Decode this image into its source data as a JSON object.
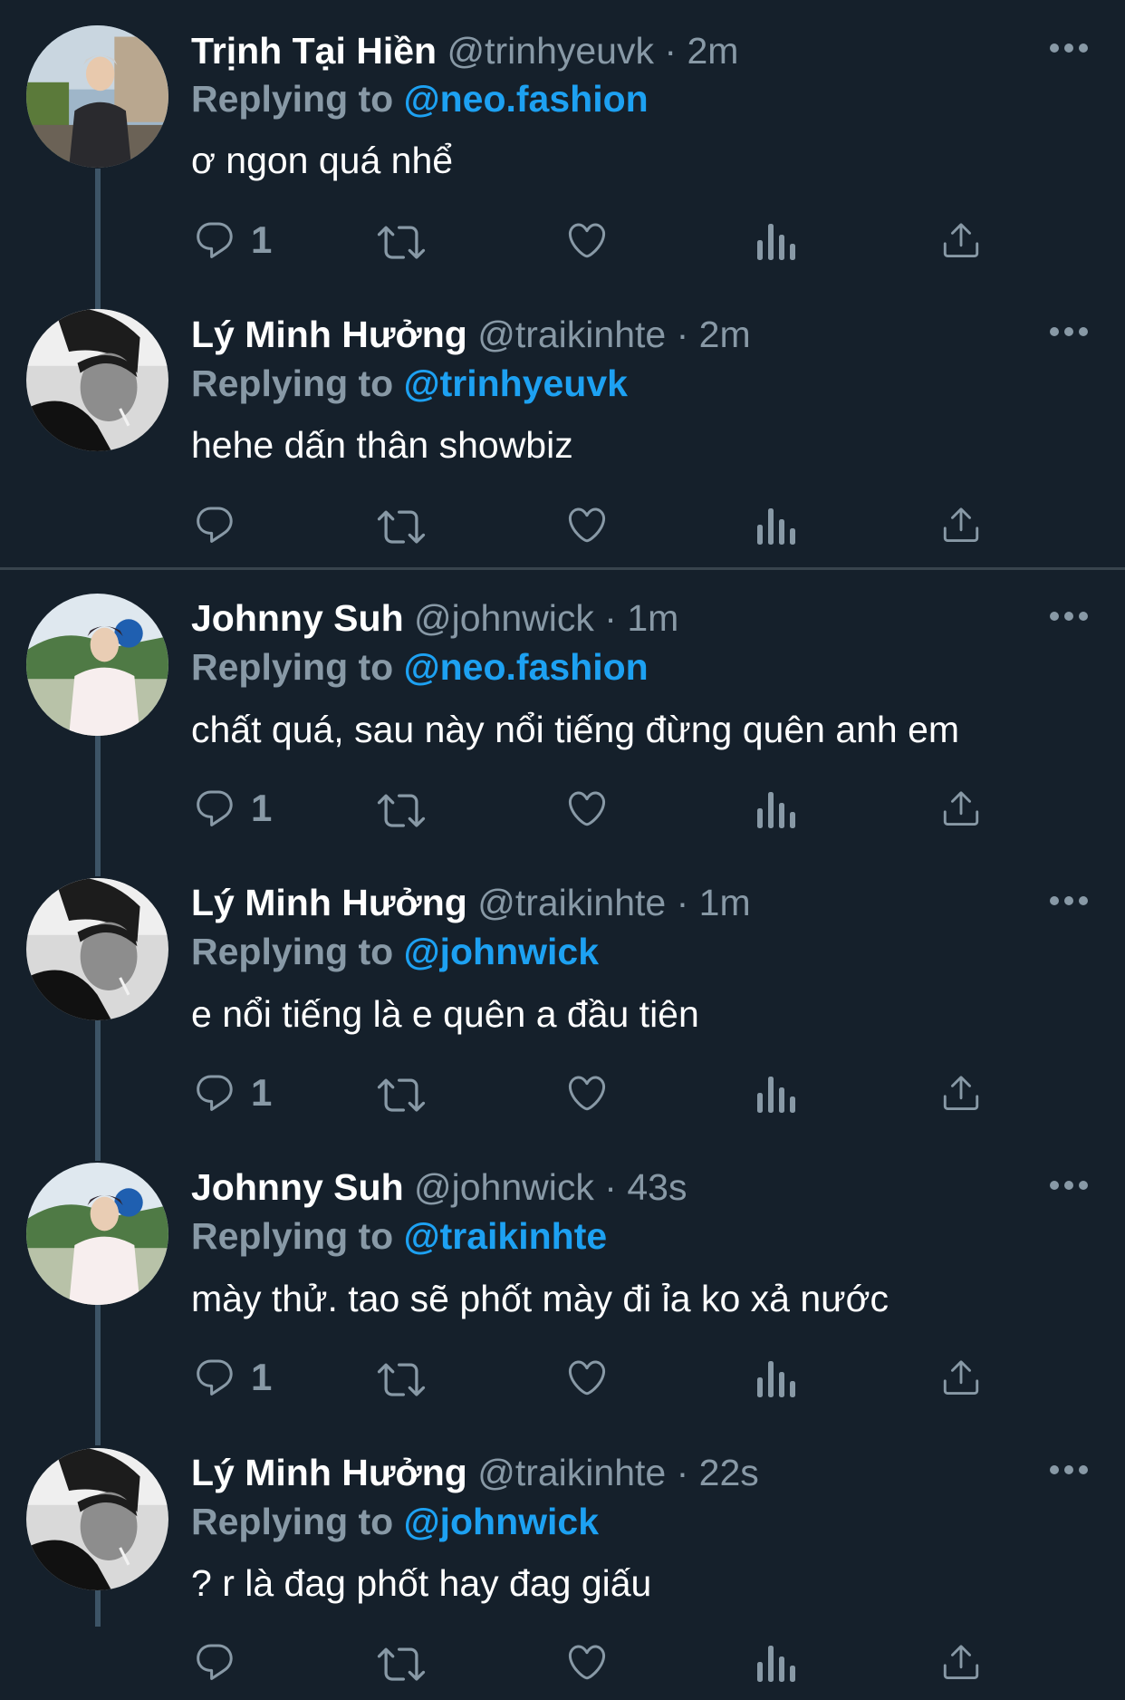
{
  "colors": {
    "background": "#15202b",
    "muted": "#8899a6",
    "link": "#1da1f2",
    "thread_line": "#3d5466",
    "divider": "#38444d"
  },
  "tweets": [
    {
      "name": "Trịnh Tại Hiền",
      "handle": "@trinhyeuvk",
      "separator": "·",
      "time": "2m",
      "replying_label": "Replying to",
      "replying_to": "@neo.fashion",
      "text": "ơ ngon quá nhể",
      "reply_count": "1",
      "icons": [
        "reply-icon",
        "retweet-icon",
        "like-icon",
        "analytics-icon",
        "share-icon",
        "more-icon"
      ]
    },
    {
      "name": "Lý Minh Hưởng",
      "handle": "@traikinhte",
      "separator": "·",
      "time": "2m",
      "replying_label": "Replying to",
      "replying_to": "@trinhyeuvk",
      "text": "hehe dấn thân showbiz",
      "reply_count": ""
    },
    {
      "name": "Johnny Suh",
      "handle": "@johnwick",
      "separator": "·",
      "time": "1m",
      "replying_label": "Replying to",
      "replying_to": "@neo.fashion",
      "text": "chất quá, sau này nổi tiếng đừng quên anh em",
      "reply_count": "1"
    },
    {
      "name": "Lý Minh Hưởng",
      "handle": "@traikinhte",
      "separator": "·",
      "time": "1m",
      "replying_label": "Replying to",
      "replying_to": "@johnwick",
      "text": "e nổi tiếng là e quên a đầu tiên",
      "reply_count": "1"
    },
    {
      "name": "Johnny Suh",
      "handle": "@johnwick",
      "separator": "·",
      "time": "43s",
      "replying_label": "Replying to",
      "replying_to": "@traikinhte",
      "text": "mày thử. tao sẽ phốt mày đi ỉa ko xả nước",
      "reply_count": "1"
    },
    {
      "name": "Lý Minh Hưởng",
      "handle": "@traikinhte",
      "separator": "·",
      "time": "22s",
      "replying_label": "Replying to",
      "replying_to": "@johnwick",
      "text": "? r là đag phốt hay đag giấu",
      "reply_count": ""
    }
  ]
}
